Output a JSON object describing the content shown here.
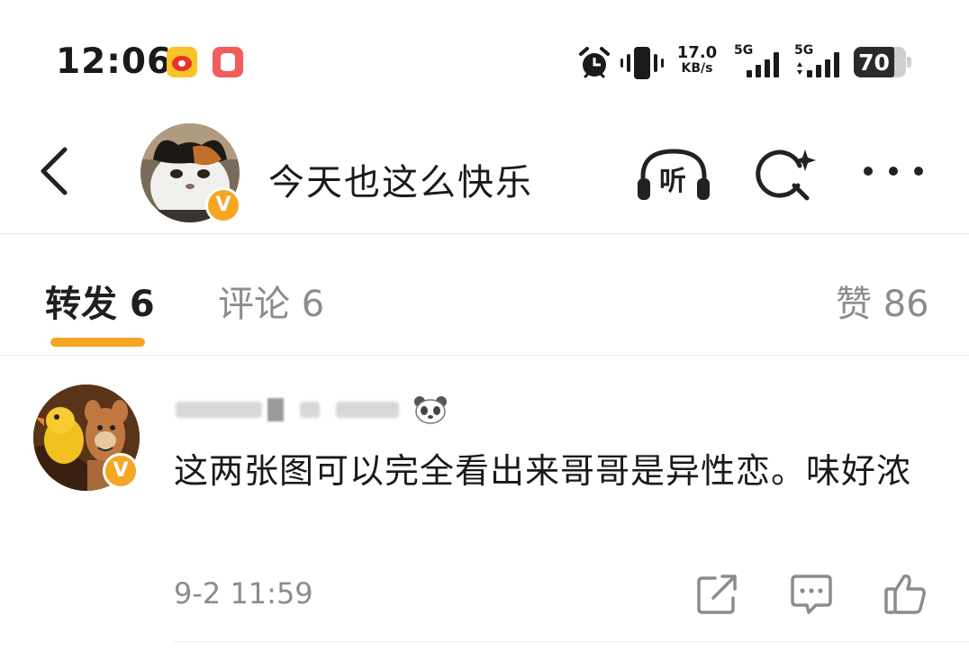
{
  "status_bar": {
    "time": "12:06",
    "net_speed_value": "17.0",
    "net_speed_unit": "KB/s",
    "signal1_label": "5G",
    "signal2_label": "5G",
    "battery": "70",
    "icons": [
      "weibo-app-icon",
      "database-app-icon",
      "alarm-icon",
      "vibrate-icon",
      "signal-icon",
      "battery-icon"
    ]
  },
  "header": {
    "title": "今天也这么快乐",
    "listen_label": "听",
    "badge_letter": "V"
  },
  "tabs": {
    "repost": "转发 6",
    "comment": "评论 6",
    "like": "赞 86",
    "accent_color": "#f5a623"
  },
  "comment": {
    "badge_letter": "V",
    "text": "这两张图可以完全看出来哥哥是异性恋。味好浓",
    "time": "9-2 11:59"
  }
}
